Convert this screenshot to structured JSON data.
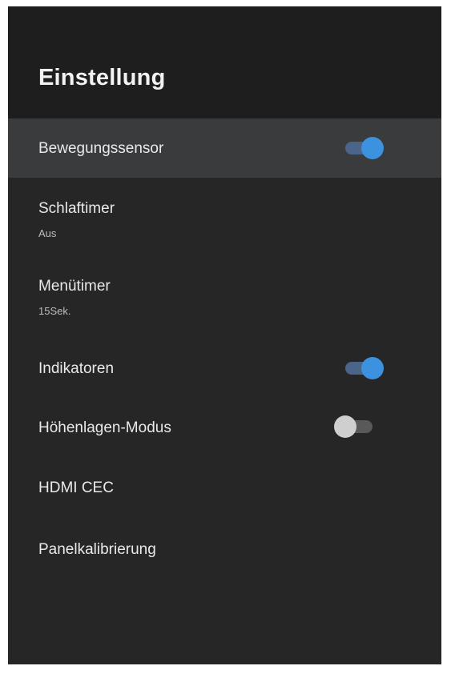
{
  "header": {
    "title": "Einstellung"
  },
  "items": [
    {
      "label": "Bewegungssensor",
      "toggle": "on"
    },
    {
      "label": "Schlaftimer",
      "value": "Aus"
    },
    {
      "label": "Menütimer",
      "value": "15Sek."
    },
    {
      "label": "Indikatoren",
      "toggle": "on"
    },
    {
      "label": "Höhenlagen-Modus",
      "toggle": "off"
    },
    {
      "label": "HDMI CEC"
    },
    {
      "label": "Panelkalibrierung"
    }
  ],
  "colors": {
    "background": "#262626",
    "header": "#1e1e1e",
    "focused_row": "#3a3b3c",
    "accent": "#3d92e0"
  }
}
